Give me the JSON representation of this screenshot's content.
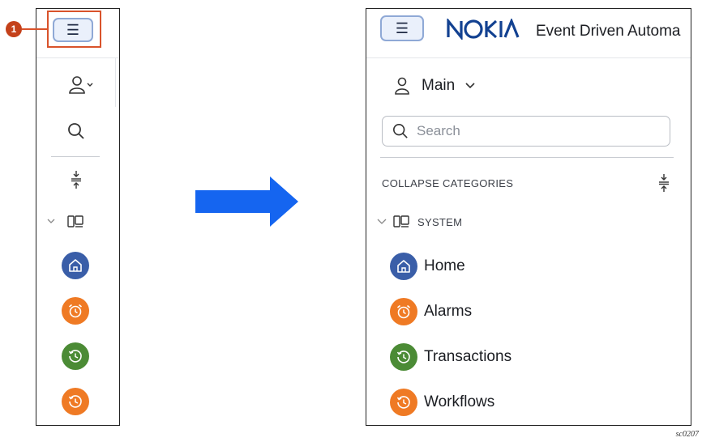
{
  "callout": {
    "number": "1"
  },
  "collapsed": {
    "menu_icon": "hamburger-icon",
    "items": [
      {
        "icon": "home-icon",
        "color": "#3a5ea8"
      },
      {
        "icon": "alarm-clock-icon",
        "color": "#ef7a24"
      },
      {
        "icon": "history-icon",
        "color": "#4b8b35"
      },
      {
        "icon": "history-icon",
        "color": "#ef7a24"
      }
    ]
  },
  "expanded": {
    "brand": "NOKIA",
    "app_title": "Event Driven Automa",
    "user": {
      "label": "Main"
    },
    "search": {
      "placeholder": "Search"
    },
    "collapse_label": "COLLAPSE CATEGORIES",
    "category": {
      "label": "SYSTEM"
    },
    "nav": [
      {
        "label": "Home",
        "icon": "home-icon",
        "color": "#3a5ea8"
      },
      {
        "label": "Alarms",
        "icon": "alarm-clock-icon",
        "color": "#ef7a24"
      },
      {
        "label": "Transactions",
        "icon": "history-icon",
        "color": "#4b8b35"
      },
      {
        "label": "Workflows",
        "icon": "history-icon",
        "color": "#ef7a24"
      }
    ]
  },
  "colors": {
    "accent_blue": "#1565f0",
    "callout": "#d9532b",
    "nokia_blue": "#124191"
  },
  "caption": "sc0207"
}
